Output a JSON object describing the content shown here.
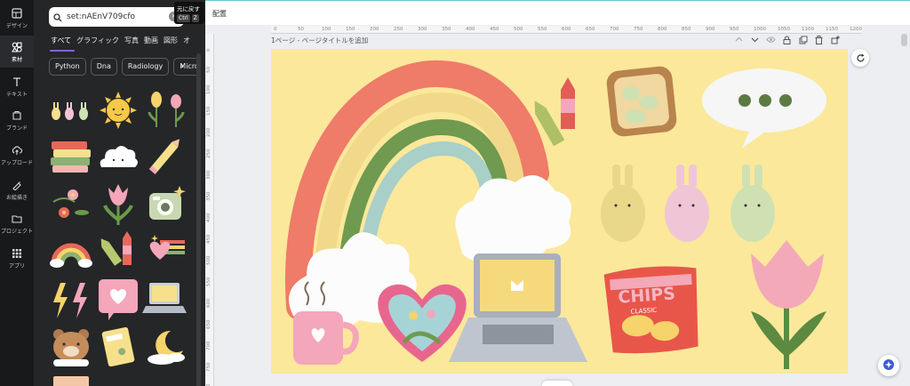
{
  "rail": {
    "items": [
      {
        "label": "デザイン",
        "icon": "layout-icon"
      },
      {
        "label": "素材",
        "icon": "elements-icon"
      },
      {
        "label": "テキスト",
        "icon": "text-icon"
      },
      {
        "label": "ブランド",
        "icon": "brand-icon"
      },
      {
        "label": "アップロード",
        "icon": "upload-icon"
      },
      {
        "label": "お絵描き",
        "icon": "draw-icon"
      },
      {
        "label": "プロジェクト",
        "icon": "folder-icon"
      },
      {
        "label": "アプリ",
        "icon": "apps-icon"
      }
    ]
  },
  "panel": {
    "search_value": "set:nAEnV709cfo",
    "tabs": [
      "すべて",
      "グラフィック",
      "写真",
      "動画",
      "図形",
      "オ"
    ],
    "chips": [
      "Python",
      "Dna",
      "Radiology",
      "Micro"
    ]
  },
  "tooltip": {
    "title": "元に戻す",
    "key1": "Ctrl",
    "key2": "Z"
  },
  "topbar": {
    "label": "配置"
  },
  "editor": {
    "page_title": "1ページ - ページタイトルを追加",
    "ruler_top": [
      "0",
      "50",
      "100",
      "150",
      "200",
      "250",
      "300",
      "350",
      "400",
      "450",
      "500",
      "550",
      "600",
      "650",
      "700",
      "750",
      "800",
      "850",
      "900",
      "950",
      "1000",
      "1050",
      "1100",
      "1150",
      "1200"
    ],
    "ruler_left": [
      "0",
      "50",
      "100",
      "150",
      "200",
      "250",
      "300",
      "350",
      "400",
      "450",
      "500",
      "550",
      "600",
      "650",
      "700",
      "750",
      "800"
    ]
  },
  "canvas": {
    "background": "#fbe89b",
    "chips_text": "CHIPS",
    "chips_sub": "CLASSIC"
  },
  "colors": {
    "accent": "#8b5cf6",
    "rail": "#18191b",
    "panel": "#252627"
  }
}
